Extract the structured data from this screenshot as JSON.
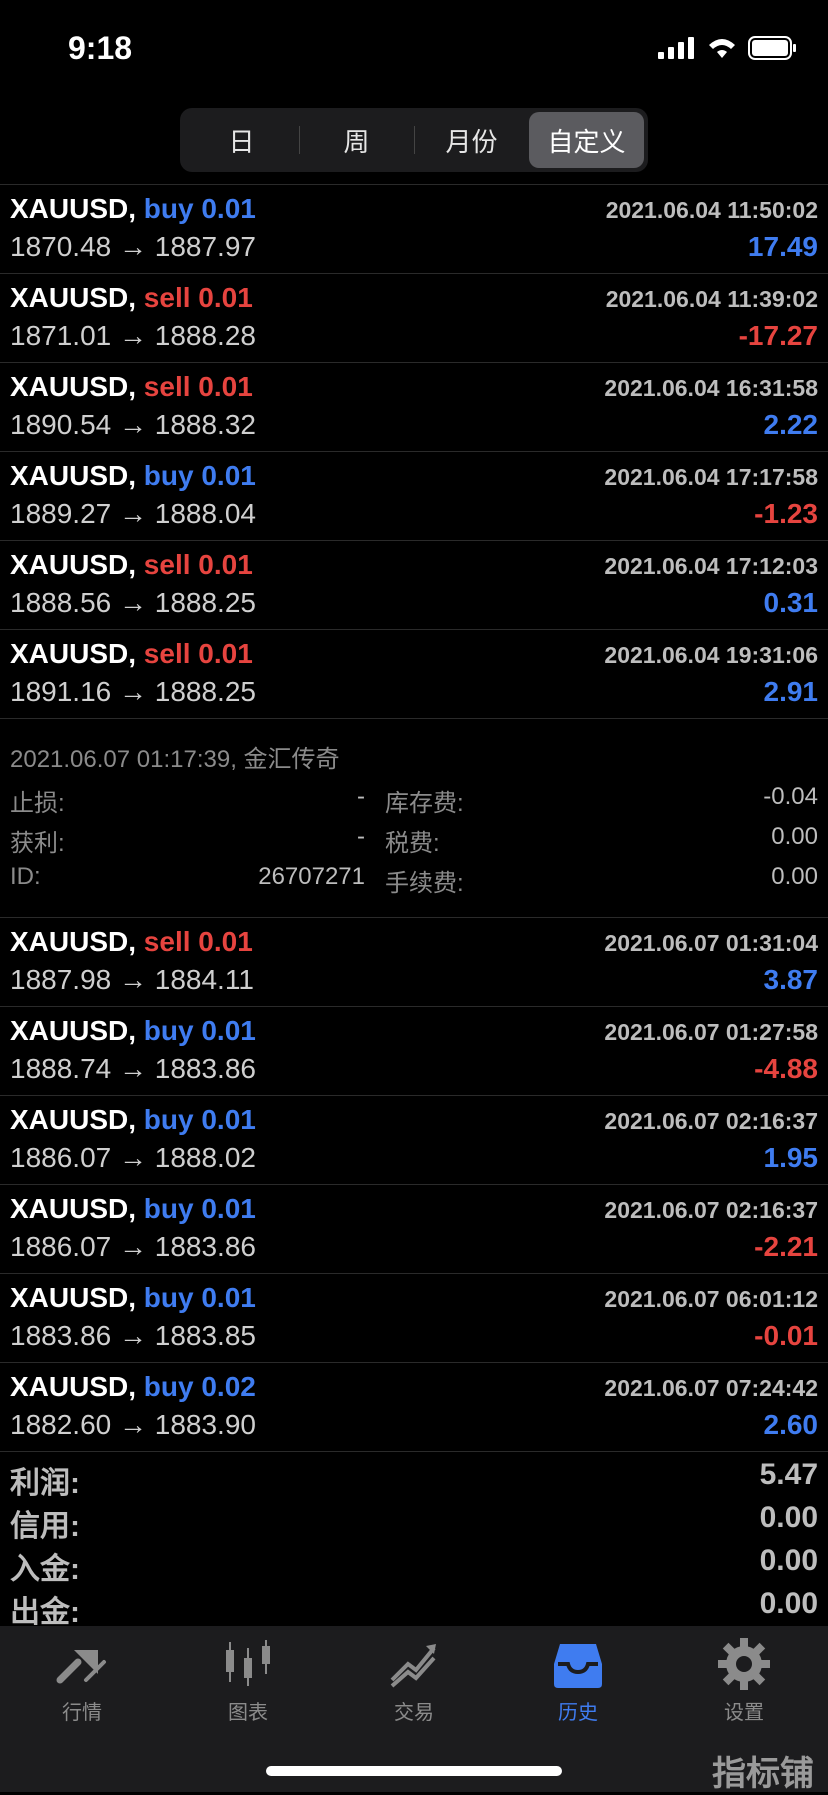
{
  "status": {
    "time": "9:18"
  },
  "segments": [
    "日",
    "周",
    "月份",
    "自定义"
  ],
  "trades": [
    {
      "symbol": "XAUUSD,",
      "side": "buy",
      "volume": "0.01",
      "timestamp": "2021.06.04 11:50:02",
      "prices": "1870.48 → 1887.97",
      "pl": "17.49",
      "pl_sign": "pos"
    },
    {
      "symbol": "XAUUSD,",
      "side": "sell",
      "volume": "0.01",
      "timestamp": "2021.06.04 11:39:02",
      "prices": "1871.01 → 1888.28",
      "pl": "-17.27",
      "pl_sign": "neg"
    },
    {
      "symbol": "XAUUSD,",
      "side": "sell",
      "volume": "0.01",
      "timestamp": "2021.06.04 16:31:58",
      "prices": "1890.54 → 1888.32",
      "pl": "2.22",
      "pl_sign": "pos"
    },
    {
      "symbol": "XAUUSD,",
      "side": "buy",
      "volume": "0.01",
      "timestamp": "2021.06.04 17:17:58",
      "prices": "1889.27 → 1888.04",
      "pl": "-1.23",
      "pl_sign": "neg"
    },
    {
      "symbol": "XAUUSD,",
      "side": "sell",
      "volume": "0.01",
      "timestamp": "2021.06.04 17:12:03",
      "prices": "1888.56 → 1888.25",
      "pl": "0.31",
      "pl_sign": "pos"
    },
    {
      "symbol": "XAUUSD,",
      "side": "sell",
      "volume": "0.01",
      "timestamp": "2021.06.04 19:31:06",
      "prices": "1891.16 → 1888.25",
      "pl": "2.91",
      "pl_sign": "pos"
    }
  ],
  "detail": {
    "header": "2021.06.07 01:17:39, 金汇传奇",
    "rows": [
      {
        "k1": "止损:",
        "v1": "-",
        "k2": "库存费:",
        "v2": "-0.04"
      },
      {
        "k1": "获利:",
        "v1": "-",
        "k2": "税费:",
        "v2": "0.00"
      },
      {
        "k1": "ID:",
        "v1": "26707271",
        "k2": "手续费:",
        "v2": "0.00"
      }
    ]
  },
  "trades2": [
    {
      "symbol": "XAUUSD,",
      "side": "sell",
      "volume": "0.01",
      "timestamp": "2021.06.07 01:31:04",
      "prices": "1887.98 → 1884.11",
      "pl": "3.87",
      "pl_sign": "pos"
    },
    {
      "symbol": "XAUUSD,",
      "side": "buy",
      "volume": "0.01",
      "timestamp": "2021.06.07 01:27:58",
      "prices": "1888.74 → 1883.86",
      "pl": "-4.88",
      "pl_sign": "neg"
    },
    {
      "symbol": "XAUUSD,",
      "side": "buy",
      "volume": "0.01",
      "timestamp": "2021.06.07 02:16:37",
      "prices": "1886.07 → 1888.02",
      "pl": "1.95",
      "pl_sign": "pos"
    },
    {
      "symbol": "XAUUSD,",
      "side": "buy",
      "volume": "0.01",
      "timestamp": "2021.06.07 02:16:37",
      "prices": "1886.07 → 1883.86",
      "pl": "-2.21",
      "pl_sign": "neg"
    },
    {
      "symbol": "XAUUSD,",
      "side": "buy",
      "volume": "0.01",
      "timestamp": "2021.06.07 06:01:12",
      "prices": "1883.86 → 1883.85",
      "pl": "-0.01",
      "pl_sign": "neg"
    },
    {
      "symbol": "XAUUSD,",
      "side": "buy",
      "volume": "0.02",
      "timestamp": "2021.06.07 07:24:42",
      "prices": "1882.60 → 1883.90",
      "pl": "2.60",
      "pl_sign": "pos"
    }
  ],
  "summary": [
    {
      "label": "利润:",
      "value": "5.47"
    },
    {
      "label": "信用:",
      "value": "0.00"
    },
    {
      "label": "入金:",
      "value": "0.00"
    },
    {
      "label": "出金:",
      "value": "0.00"
    }
  ],
  "tabs": [
    {
      "label": "行情",
      "icon": "quotes-icon"
    },
    {
      "label": "图表",
      "icon": "chart-icon"
    },
    {
      "label": "交易",
      "icon": "trade-icon"
    },
    {
      "label": "历史",
      "icon": "history-icon",
      "active": true
    },
    {
      "label": "设置",
      "icon": "settings-icon"
    }
  ],
  "watermark": "指标铺",
  "colors": {
    "buy": "#3f7cf0",
    "sell": "#e6443f",
    "active_tab": "#3f7cf0"
  }
}
